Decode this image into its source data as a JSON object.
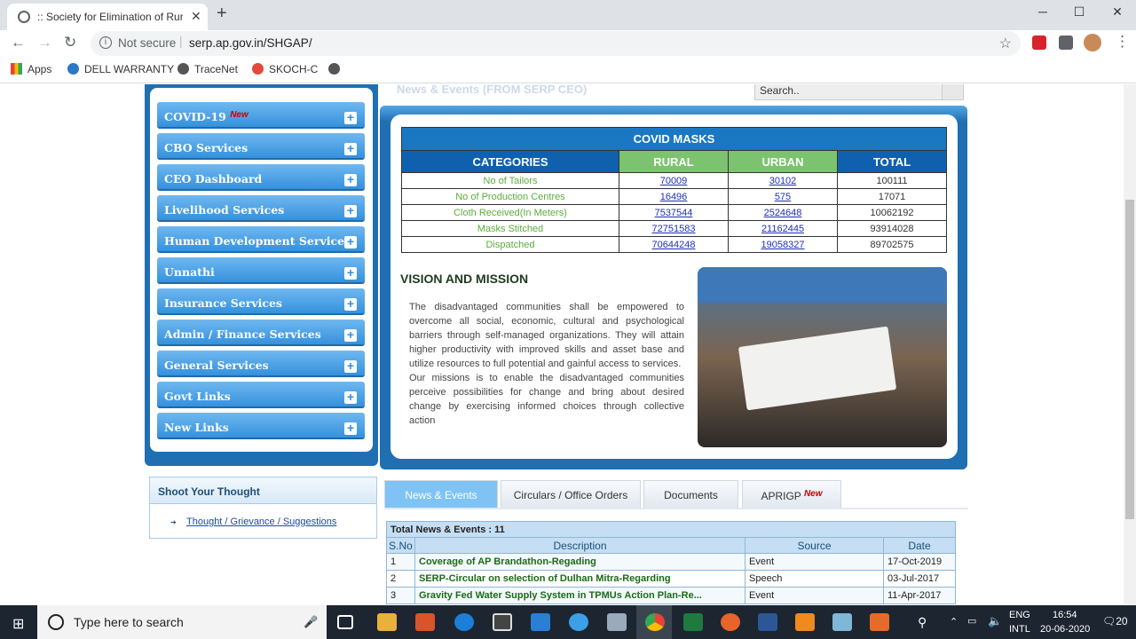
{
  "browser": {
    "tab_title": ":: Society for Elimination of Rural",
    "tab_close": "✕",
    "new_tab": "+",
    "window_controls": [
      "─",
      "☐",
      "✕"
    ],
    "security": "Not secure",
    "url": "serp.ap.gov.in/SHGAP/",
    "bookmarks": [
      "Apps",
      "DELL WARRANTY",
      "TraceNet",
      "SKOCH-C"
    ]
  },
  "page": {
    "news_events_header": "News & Events (FROM SERP CEO)",
    "search_placeholder": "Search..",
    "menu": [
      {
        "label": "COVID-19",
        "new": "New"
      },
      {
        "label": "CBO Services"
      },
      {
        "label": "CEO Dashboard"
      },
      {
        "label": "Livelihood Services"
      },
      {
        "label": "Human Development Services"
      },
      {
        "label": "Unnathi"
      },
      {
        "label": "Insurance Services"
      },
      {
        "label": "Admin / Finance Services"
      },
      {
        "label": "General Services"
      },
      {
        "label": "Govt Links"
      },
      {
        "label": "New Links"
      }
    ],
    "plus_symbol": "+",
    "thought": {
      "heading": "Shoot Your Thought",
      "link": "Thought / Grievance / Suggestions"
    },
    "covid_table": {
      "caption": "COVID MASKS",
      "headers": [
        "CATEGORIES",
        "RURAL",
        "URBAN",
        "TOTAL"
      ],
      "rows": [
        [
          "No of Tailors",
          "70009",
          "30102",
          "100111"
        ],
        [
          "No of Production Centres",
          "16496",
          "575",
          "17071"
        ],
        [
          "Cloth Received(In Meters)",
          "7537544",
          "2524648",
          "10062192"
        ],
        [
          "Masks Stitched",
          "72751583",
          "21162445",
          "93914028"
        ],
        [
          "Dispatched",
          "70644248",
          "19058327",
          "89702575"
        ]
      ]
    },
    "vision": {
      "title": "VISION AND MISSION",
      "paragraph1": "The disadvantaged communities shall be empowered to overcome all social, economic, cultural and psychological barriers through self-managed organizations. They will attain higher productivity with improved skills and asset base and utilize resources to full potential and gainful access to services.",
      "paragraph2": "Our missions is to enable the disadvantaged communities perceive possibilities for change and bring about desired change by exercising informed choices through collective action"
    },
    "tabs": [
      "News & Events",
      "Circulars / Office Orders",
      "Documents",
      "APRIGP"
    ],
    "tabs_new": "New",
    "news_table": {
      "total": "Total News & Events : 11",
      "headers": [
        "S.No",
        "Description",
        "Source",
        "Date"
      ],
      "rows": [
        [
          "1",
          "Coverage of AP Brandathon-Regading",
          "Event",
          "17-Oct-2019"
        ],
        [
          "2",
          "SERP-Circular on selection of Dulhan Mitra-Regarding",
          "Speech",
          "03-Jul-2017"
        ],
        [
          "3",
          "Gravity Fed Water Supply System in TPMUs Action Plan-Re...",
          "Event",
          "11-Apr-2017"
        ]
      ]
    }
  },
  "taskbar": {
    "search_placeholder": "Type here to search",
    "lang": "ENG",
    "layout": "INTL",
    "time": "16:54",
    "date": "20-06-2020",
    "notifications": "20"
  }
}
